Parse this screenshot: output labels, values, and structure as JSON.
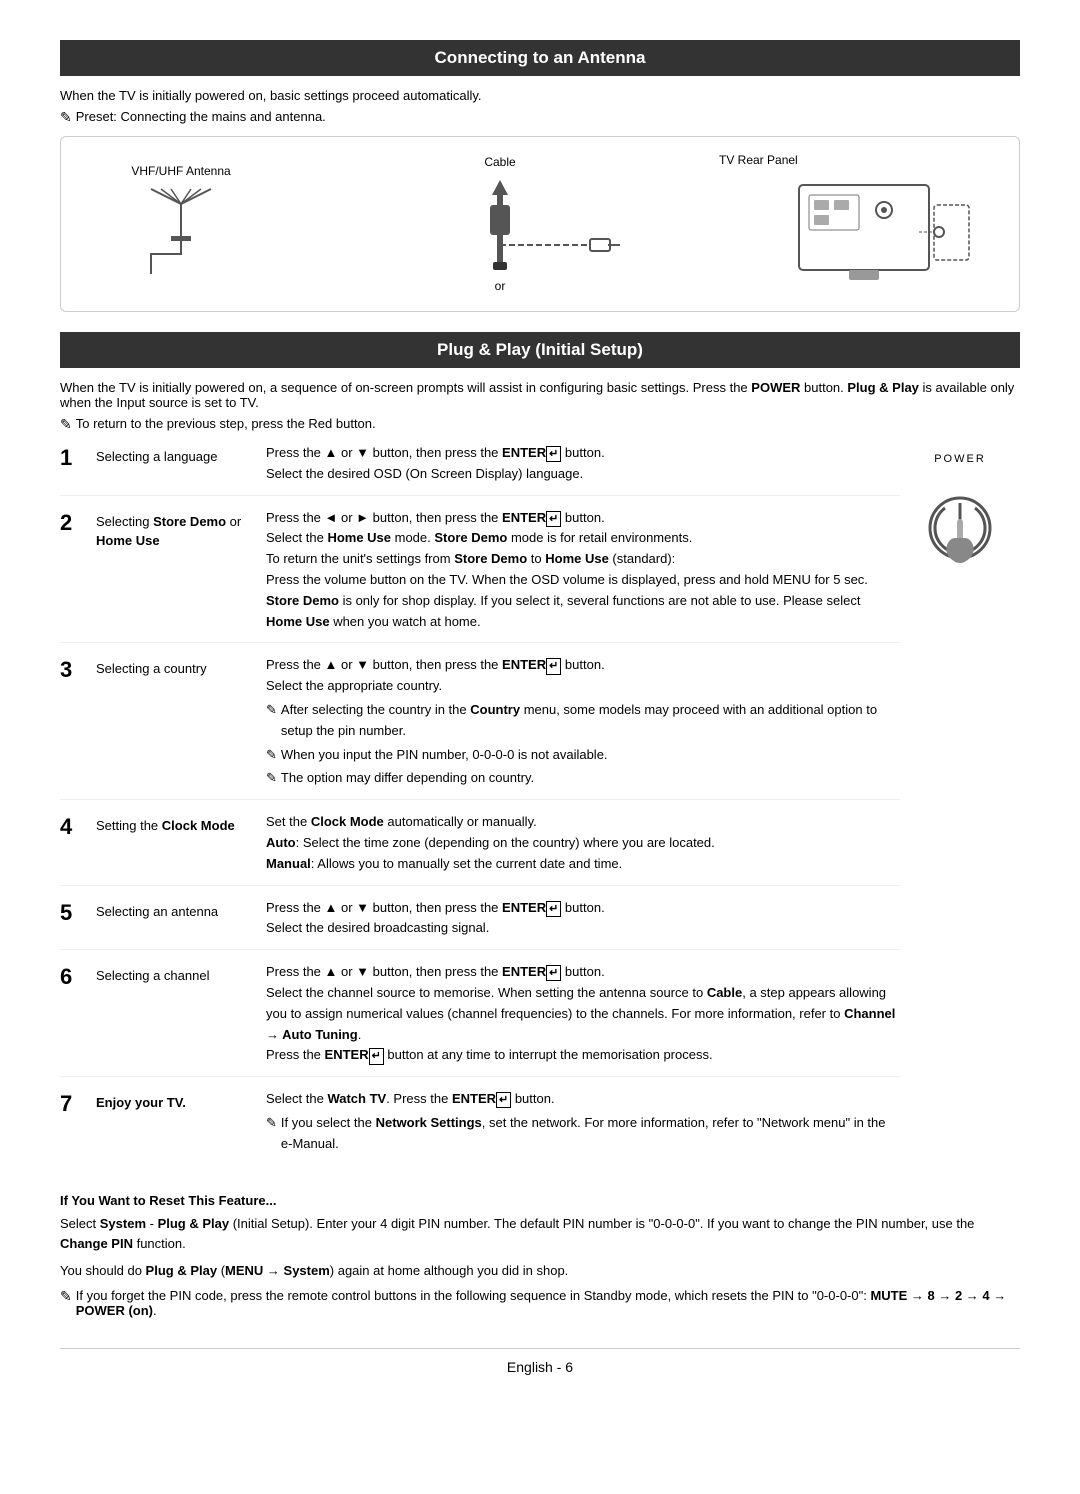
{
  "antenna_section": {
    "header": "Connecting to an Antenna",
    "intro": "When the TV is initially powered on, basic settings proceed automatically.",
    "note": "Preset: Connecting the mains and antenna.",
    "diagram": {
      "left_label": "VHF/UHF Antenna",
      "cable_label": "Cable",
      "tv_rear_label": "TV Rear Panel"
    }
  },
  "plug_play_section": {
    "header": "Plug & Play (Initial Setup)",
    "intro": "When the TV is initially powered on, a sequence of on-screen prompts will assist in configuring basic settings. Press the POWER button. Plug & Play is available only when the Input source is set to TV.",
    "note": "To return to the previous step, press the Red button.",
    "power_label": "POWER",
    "steps": [
      {
        "number": "1",
        "title": "Selecting a language",
        "content": "Press the ▲ or ▼ button, then press the ENTER button.\nSelect the desired OSD (On Screen Display) language."
      },
      {
        "number": "2",
        "title_bold1": "Selecting ",
        "title_bold2": "Store Demo",
        "title_mid": " or ",
        "title_bold3": "Home Use",
        "title_plain": "",
        "content_line1": "Press the ◄ or ► button, then press the ENTER button.",
        "content_line2": "Select the Home Use mode. Store Demo mode is for retail environments.",
        "content_line3": "To return the unit's settings from Store Demo to Home Use (standard):",
        "content_line4": "Press the volume button on the TV. When the OSD volume is displayed, press and hold MENU for 5 sec.",
        "content_line5": "Store Demo is only for shop display. If you select it, several functions are not able to use. Please select Home Use when you watch at home."
      },
      {
        "number": "3",
        "title": "Selecting a country",
        "content_line1": "Press the ▲ or ▼ button, then press the ENTER button.",
        "content_line2": "Select the appropriate country.",
        "content_note1": "After selecting the country in the Country menu, some models may proceed with an additional option to setup the pin number.",
        "content_note2": "When you input the PIN number, 0-0-0-0 is not available.",
        "content_note3": "The option may differ depending on country."
      },
      {
        "number": "4",
        "title": "Setting the Clock Mode",
        "content_line1": "Set the Clock Mode automatically or manually.",
        "content_line2": "Auto: Select the time zone (depending on the country) where you are located.",
        "content_line3": "Manual: Allows you to manually set the current date and time."
      },
      {
        "number": "5",
        "title": "Selecting an antenna",
        "content_line1": "Press the ▲ or ▼ button, then press the ENTER button.",
        "content_line2": "Select the desired broadcasting signal."
      },
      {
        "number": "6",
        "title": "Selecting a channel",
        "content_line1": "Press the ▲ or ▼ button, then press the ENTER button.",
        "content_line2": "Select the channel source to memorise. When setting the antenna source to Cable, a step appears allowing you to assign numerical values (channel frequencies) to the channels. For more information, refer to Channel → Auto Tuning.",
        "content_line3": "Press the ENTER button at any time to interrupt the memorisation process."
      },
      {
        "number": "7",
        "title": "Enjoy your TV.",
        "content_line1": "Select the Watch TV. Press the ENTER button.",
        "content_note1": "If you select the Network Settings, set the network. For more information, refer to \"Network menu\" in the e-Manual."
      }
    ],
    "reset_section": {
      "title": "If You Want to Reset This Feature...",
      "text1": "Select System - Plug & Play (Initial Setup). Enter your 4 digit PIN number. The default PIN number is \"0-0-0-0\". If you want to change the PIN number, use the Change PIN function.",
      "text2": "You should do Plug & Play (MENU → System) again at home although you did in shop.",
      "note1": "If you forget the PIN code, press the remote control buttons in the following sequence in Standby mode, which resets the PIN to \"0-0-0-0\": MUTE → 8 → 2 → 4 → POWER (on)."
    }
  },
  "footer": {
    "text": "English - 6"
  }
}
